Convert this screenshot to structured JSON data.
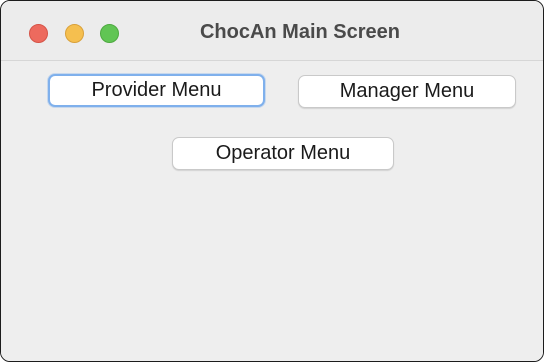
{
  "window": {
    "title": "ChocAn Main Screen",
    "controls": [
      "close-icon",
      "minimize-icon",
      "zoom-icon"
    ]
  },
  "buttons": {
    "provider_menu": "Provider Menu",
    "manager_menu": "Manager Menu",
    "operator_menu": "Operator Menu",
    "focused": "provider_menu"
  },
  "colors": {
    "close": "#ed6a5e",
    "minimize": "#f5bf4f",
    "zoom": "#61c554",
    "focus_ring": "#7fb0ec",
    "window_bg": "#ececec"
  }
}
